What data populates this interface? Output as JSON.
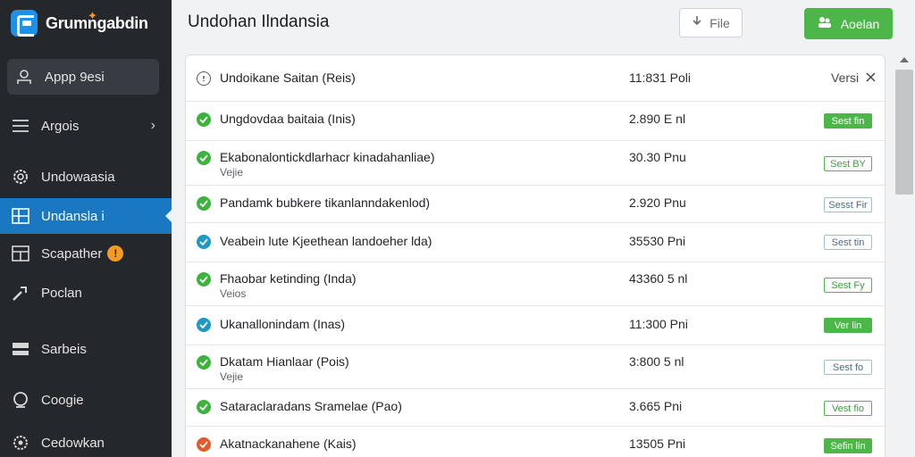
{
  "brand": {
    "name": "Grumngabdin"
  },
  "sidebar": {
    "items": [
      {
        "label": "Appp 9esi",
        "icon": "user-icon"
      },
      {
        "label": "Argois",
        "icon": "menu-icon"
      },
      {
        "label": "Undowaasia",
        "icon": "gear-icon"
      },
      {
        "label": "Undansla i",
        "icon": "layout-icon"
      },
      {
        "label": "Scapather",
        "icon": "grid-icon",
        "badge": "!"
      },
      {
        "label": "Poclan",
        "icon": "wrench-icon"
      },
      {
        "label": "Sarbeis",
        "icon": "server-icon"
      },
      {
        "label": "Coogie",
        "icon": "circle-icon"
      },
      {
        "label": "Cedowkan",
        "icon": "cog-icon"
      }
    ]
  },
  "header": {
    "title": "Undohan Ilndansia",
    "file_button": "File",
    "primary_button": "Aoelan"
  },
  "list": {
    "rows": [
      {
        "status": "pending",
        "name": "Undoikane Saitan (Reis)",
        "sub": "",
        "time": "11:831 Poli",
        "action": "Versi",
        "tag": "",
        "tag_style": ""
      },
      {
        "status": "ok",
        "name": "Ungdovdaa baitaia (Inis)",
        "sub": "",
        "time": "2.890 E nl",
        "action": "",
        "tag": "Sest fin",
        "tag_style": "solid"
      },
      {
        "status": "ok",
        "name": "Ekabonalontickdlarhacr kinadahanliae)",
        "sub": "Vejie",
        "time": "30.30 Pnu",
        "action": "",
        "tag": "Sest BY",
        "tag_style": "outline"
      },
      {
        "status": "ok",
        "name": "Pandamk bubkere tikanlanndakenlod)",
        "sub": "",
        "time": "2.920 Pnu",
        "action": "",
        "tag": "Sesst Fir",
        "tag_style": "outline-gray"
      },
      {
        "status": "info",
        "name": "Veabein lute Kjeethean landoeher lda)",
        "sub": "",
        "time": "35530 Pni",
        "action": "",
        "tag": "Sest tin",
        "tag_style": "outline-gray"
      },
      {
        "status": "ok",
        "name": "Fhaobar ketinding (Inda)",
        "sub": "Veios",
        "time": "43360 5 nl",
        "action": "",
        "tag": "Sest Fy",
        "tag_style": "outline"
      },
      {
        "status": "info",
        "name": "Ukanallonindam (Inas)",
        "sub": "",
        "time": "11:300 Pni",
        "action": "",
        "tag": "Ver lin",
        "tag_style": "solid"
      },
      {
        "status": "ok",
        "name": "Dkatam Hianlaar (Pois)",
        "sub": "Vejie",
        "time": "3:800 5 nl",
        "action": "",
        "tag": "Sest fo",
        "tag_style": "outline-gray"
      },
      {
        "status": "ok",
        "name": "Sataraclaradans Sramelae (Pao)",
        "sub": "",
        "time": "3.665 Pni",
        "action": "",
        "tag": "Vest fio",
        "tag_style": "outline"
      },
      {
        "status": "err",
        "name": "Akatnackanahene (Kais)",
        "sub": "",
        "time": "13505 Pni",
        "action": "",
        "tag": "Sefin lin",
        "tag_style": "solid"
      }
    ]
  },
  "colors": {
    "sidebar_bg": "#24272b",
    "active": "#1a78c2",
    "accent_green": "#4cb649",
    "badge_orange": "#f39b25",
    "error": "#e35a2c"
  }
}
